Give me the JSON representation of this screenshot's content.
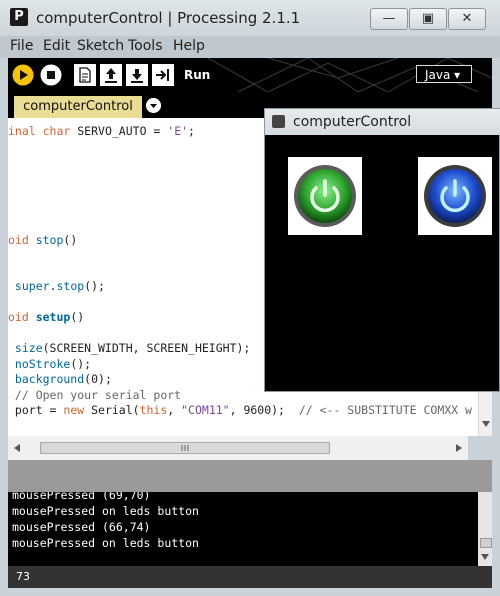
{
  "window": {
    "title": "computerControl | Processing 2.1.1",
    "app_icon": "P",
    "controls": {
      "minimize": "—",
      "maximize": "▣",
      "close": "✕"
    }
  },
  "menu": [
    "File",
    "Edit",
    "Sketch",
    "Tools",
    "Help"
  ],
  "toolbar": {
    "run_label": "Run",
    "mode_label": "Java ▾",
    "icons": [
      "play-icon",
      "stop-icon",
      "new-icon",
      "open-icon",
      "save-icon",
      "export-icon"
    ]
  },
  "tabs": [
    {
      "label": "computerControl"
    }
  ],
  "code": [
    {
      "parts": [
        [
          "inal ",
          "kw"
        ],
        [
          "char",
          "kw"
        ],
        [
          " SERVO_AUTO = ",
          "plain"
        ],
        [
          "'E'",
          "str"
        ],
        [
          ";",
          "plain"
        ]
      ]
    },
    {
      "parts": []
    },
    {
      "parts": []
    },
    {
      "parts": []
    },
    {
      "parts": []
    },
    {
      "parts": []
    },
    {
      "parts": []
    },
    {
      "parts": [
        [
          "oid ",
          "kw"
        ],
        [
          "stop",
          "fn"
        ],
        [
          "()",
          "plain"
        ]
      ]
    },
    {
      "parts": []
    },
    {
      "parts": []
    },
    {
      "parts": [
        [
          " super",
          "fn"
        ],
        [
          ".",
          "plain"
        ],
        [
          "stop",
          "fn"
        ],
        [
          "();",
          "plain"
        ]
      ]
    },
    {
      "parts": []
    },
    {
      "parts": [
        [
          "oid ",
          "kw"
        ],
        [
          "setup",
          "fnb"
        ],
        [
          "()",
          "plain"
        ]
      ]
    },
    {
      "parts": []
    },
    {
      "parts": [
        [
          " size",
          "fn"
        ],
        [
          "(SCREEN_WIDTH, SCREEN_HEIGHT);",
          "plain"
        ]
      ]
    },
    {
      "parts": [
        [
          " noStroke",
          "fn"
        ],
        [
          "();",
          "plain"
        ]
      ]
    },
    {
      "parts": [
        [
          " background",
          "fn"
        ],
        [
          "(0);",
          "plain"
        ]
      ]
    },
    {
      "parts": [
        [
          " // Open your serial port",
          "cmt"
        ]
      ]
    },
    {
      "parts": [
        [
          " port = ",
          "plain"
        ],
        [
          "new",
          "kw"
        ],
        [
          " Serial(",
          "plain"
        ],
        [
          "this",
          "kw"
        ],
        [
          ", ",
          "plain"
        ],
        [
          "\"COM11\"",
          "str"
        ],
        [
          ", 9600);  ",
          "plain"
        ],
        [
          "// <-- SUBSTITUTE COMXX w",
          "cmt"
        ]
      ]
    }
  ],
  "console": [
    "mousePressed (69,70)",
    "mousePressed on leds button",
    "mousePressed (66,74)",
    "mousePressed on leds button"
  ],
  "status": {
    "line": "73"
  },
  "sketch_window": {
    "title": "computerControl",
    "buttons": [
      {
        "name": "green-power-button",
        "color": "#2ea52e"
      },
      {
        "name": "blue-power-button",
        "color": "#1f4fd0"
      }
    ]
  },
  "colors": {
    "keyword": "#cc6633",
    "function": "#006699",
    "string": "#7d4793",
    "comment": "#666666",
    "tab": "#e8dd93"
  }
}
